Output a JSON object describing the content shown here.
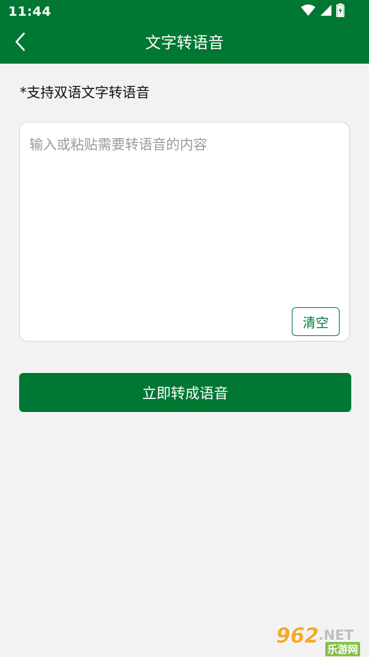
{
  "status_bar": {
    "time": "11:44",
    "icons": [
      "wifi-icon",
      "signal-icon",
      "battery-charging-icon"
    ]
  },
  "app_bar": {
    "back_icon": "back-arrow-icon",
    "title": "文字转语音"
  },
  "main": {
    "hint": "*支持双语文字转语音",
    "input": {
      "value": "",
      "placeholder": "输入或粘贴需要转语音的内容"
    },
    "clear_label": "清空",
    "convert_label": "立即转成语音"
  },
  "watermark": {
    "number": "962",
    "tld": ".NET",
    "cn": "乐游网"
  },
  "colors": {
    "primary": "#007733",
    "background": "#f2f2f2",
    "card": "#ffffff",
    "placeholder": "#9a9a9a"
  }
}
